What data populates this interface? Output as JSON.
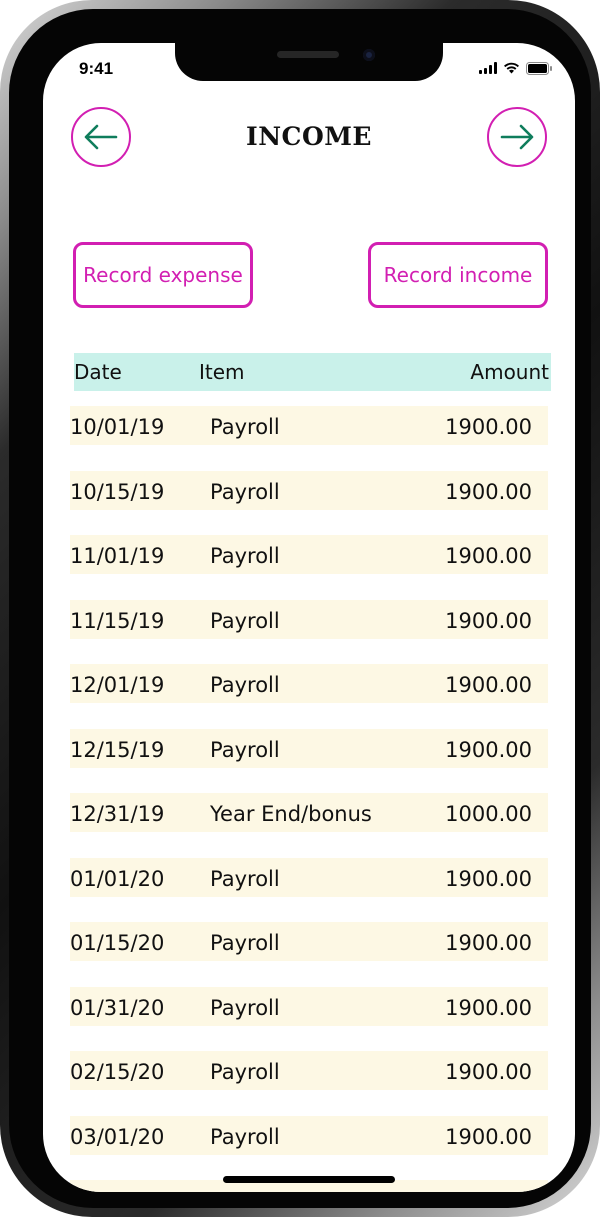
{
  "status_bar": {
    "time": "9:41"
  },
  "header": {
    "title": "INCOME"
  },
  "actions": {
    "record_expense": "Record expense",
    "record_income": "Record income"
  },
  "table": {
    "columns": {
      "date": "Date",
      "item": "Item",
      "amount": "Amount"
    },
    "rows": [
      {
        "date": "10/01/19",
        "item": "Payroll",
        "amount": "1900.00"
      },
      {
        "date": "10/15/19",
        "item": "Payroll",
        "amount": "1900.00"
      },
      {
        "date": "11/01/19",
        "item": "Payroll",
        "amount": "1900.00"
      },
      {
        "date": "11/15/19",
        "item": "Payroll",
        "amount": "1900.00"
      },
      {
        "date": "12/01/19",
        "item": "Payroll",
        "amount": "1900.00"
      },
      {
        "date": "12/15/19",
        "item": "Payroll",
        "amount": "1900.00"
      },
      {
        "date": "12/31/19",
        "item": "Year End/bonus",
        "amount": "1000.00"
      },
      {
        "date": "01/01/20",
        "item": "Payroll",
        "amount": "1900.00"
      },
      {
        "date": "01/15/20",
        "item": "Payroll",
        "amount": "1900.00"
      },
      {
        "date": "01/31/20",
        "item": "Payroll",
        "amount": "1900.00"
      },
      {
        "date": "02/15/20",
        "item": "Payroll",
        "amount": "1900.00"
      },
      {
        "date": "03/01/20",
        "item": "Payroll",
        "amount": "1900.00"
      }
    ]
  },
  "colors": {
    "accent": "#d21fb2",
    "arrow": "#0f7d5c",
    "header_row": "#c9f1ea",
    "row_bg": "#fdf8e4"
  },
  "icons": {
    "back": "arrow-left-icon",
    "forward": "arrow-right-icon",
    "signal": "cellular-signal-icon",
    "wifi": "wifi-icon",
    "battery": "battery-icon"
  }
}
